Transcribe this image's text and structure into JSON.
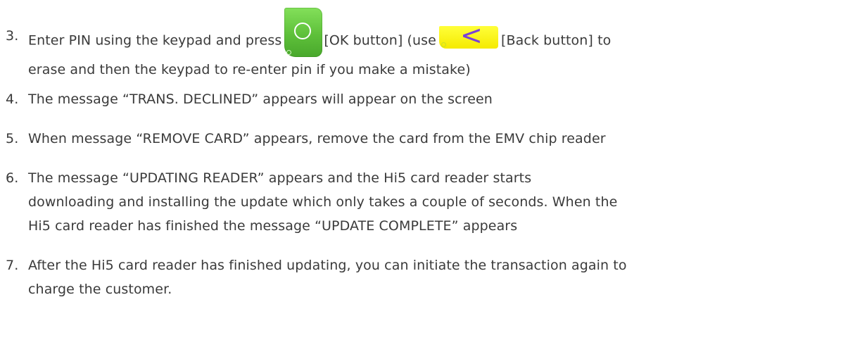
{
  "steps": [
    {
      "number": "3.",
      "lines": [
        {
          "a": "Enter PIN using the keypad and press",
          "ok_label": "[OK button] (use",
          "back_label": "[Back button] to"
        },
        "erase and then the keypad to re-enter pin if you make a mistake)"
      ]
    },
    {
      "number": "4.",
      "lines": [
        "The message “TRANS. DECLINED” appears will appear on the screen"
      ]
    },
    {
      "number": "5.",
      "lines": [
        "When message “REMOVE CARD” appears, remove the card from the EMV chip reader"
      ]
    },
    {
      "number": "6.",
      "lines": [
        "The message “UPDATING READER” appears and the Hi5 card reader starts",
        "downloading and installing the update which only takes a couple of seconds. When the",
        "Hi5 card reader has finished the message “UPDATE COMPLETE” appears"
      ]
    },
    {
      "number": "7.",
      "lines": [
        "After the Hi5 card reader has finished updating, you can initiate the transaction again to",
        "charge the customer."
      ]
    }
  ],
  "icons": {
    "ok_button": "ok-circle-icon",
    "back_button": "chevron-left-icon",
    "back_glyph": "<"
  },
  "colors": {
    "text": "#3a3a3a",
    "ok_button": "#5ec03a",
    "back_button": "#f5ea00",
    "back_chevron": "#7a40d8"
  }
}
